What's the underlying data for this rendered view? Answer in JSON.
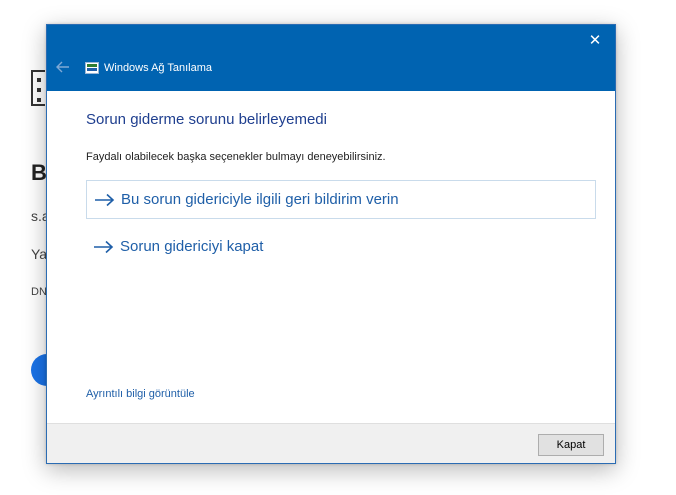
{
  "background_page": {
    "heading_fragment": "B",
    "line1": "s.a",
    "line2": "Ya",
    "line3": "DN"
  },
  "window": {
    "title": "Windows Ağ Tanılama",
    "close_glyph": "✕"
  },
  "content": {
    "heading": "Sorun giderme sorunu belirleyemedi",
    "subtext": "Faydalı olabilecek başka seçenekler bulmayı deneyebilirsiniz.",
    "options": [
      {
        "label": "Bu sorun gidericiyle ilgili geri bildirim verin",
        "icon": "arrow-right-icon",
        "selected": true
      },
      {
        "label": "Sorun gidericiyi kapat",
        "icon": "arrow-right-icon",
        "selected": false
      }
    ],
    "details_link": "Ayrıntılı bilgi görüntüle"
  },
  "footer": {
    "close_button": "Kapat"
  },
  "colors": {
    "titlebar": "#0063b1",
    "heading": "#1f3f8f",
    "link": "#1f5fa8"
  }
}
